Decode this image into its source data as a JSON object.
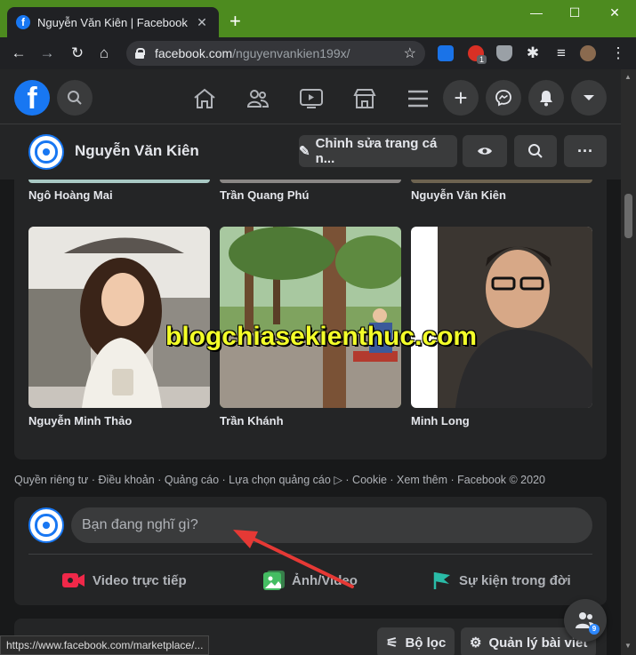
{
  "browser": {
    "tab_title": "Nguyễn Văn Kiên | Facebook",
    "tab_favicon": "f",
    "new_tab": "+",
    "url_host": "facebook.com",
    "url_path": "/nguyenvankien199x/",
    "extension_badge": "1",
    "status_url": "https://www.facebook.com/marketplace/..."
  },
  "fb": {
    "logo": "f",
    "profile_name": "Nguyễn Văn Kiên",
    "edit_profile": "Chỉnh sửa trang cá n...",
    "friends_row1": [
      "Ngô Hoàng Mai",
      "Trần Quang Phú",
      "Nguyễn Văn Kiên"
    ],
    "friends_row2": [
      "Nguyễn Minh Thảo",
      "Trần Khánh",
      "Minh Long"
    ],
    "footer": "Quyền riêng tư · Điều khoản · Quảng cáo · Lựa chọn quảng cáo ▷ · Cookie · Xem thêm · Facebook © 2020",
    "composer_placeholder": "Bạn đang nghĩ gì?",
    "actions": {
      "live": "Video trực tiếp",
      "photo": "Ảnh/Video",
      "life_event": "Sự kiện trong đời"
    },
    "filter": "Bộ lọc",
    "manage_posts": "Quản lý bài viết",
    "chat_badge": "9"
  },
  "watermark": "blogchiasekienthuc.com",
  "colors": {
    "titlebar": "#4d8b1f",
    "fb_blue": "#1877f2",
    "annotation_arrow": "#e53935"
  }
}
